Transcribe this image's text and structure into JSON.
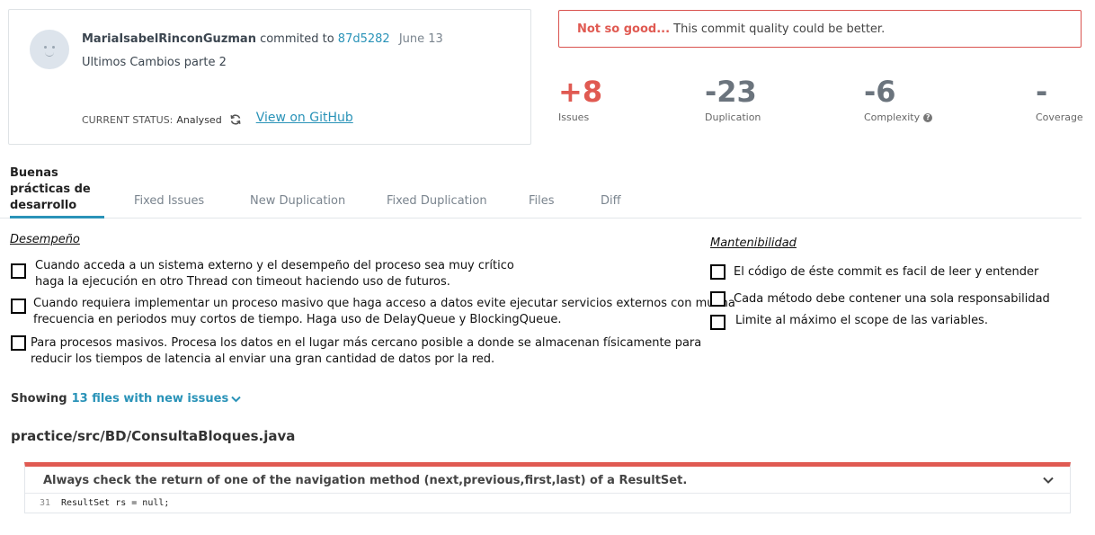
{
  "commit": {
    "author": "MariaIsabelRinconGuzman",
    "verb": " commited to ",
    "hash": "87d5282",
    "date": "June 13",
    "message": "Ultimos Cambios parte 2",
    "status_label": "CURRENT STATUS:",
    "status_value": "Analysed",
    "github_link": "View on GitHub"
  },
  "quality": {
    "strong": "Not so good...",
    "text": " This commit quality could be better."
  },
  "metrics": [
    {
      "value": "+8",
      "label": "Issues",
      "color": "#e05a52"
    },
    {
      "value": "-23",
      "label": "Duplication",
      "color": "#6b747d"
    },
    {
      "value": "-6",
      "label": "Complexity",
      "color": "#6b747d"
    },
    {
      "value": "-",
      "label": "Coverage",
      "color": "#6b747d"
    }
  ],
  "tabs": {
    "active": [
      "Buenas",
      "prácticas de",
      "desarrollo"
    ],
    "items": [
      "Fixed Issues",
      "New Duplication",
      "Fixed Duplication",
      "Files",
      "Diff"
    ]
  },
  "desempeno": {
    "title": "Desempeño",
    "items": [
      [
        "Cuando acceda a un sistema externo y el desempeño del proceso sea muy crítico",
        "haga la ejecución en otro Thread con timeout haciendo uso de futuros."
      ],
      [
        "Cuando requiera implementar un proceso masivo que haga acceso a datos evite ejecutar servicios externos con mucha",
        "frecuencia en periodos muy cortos de tiempo. Haga uso de DelayQueue y BlockingQueue."
      ],
      [
        "Para procesos masivos. Procesa los datos en el lugar más cercano posible a donde se almacenan físicamente para",
        "reducir los tiempos de latencia al enviar una gran cantidad de datos por la red."
      ]
    ]
  },
  "mantenibilidad": {
    "title": "Mantenibilidad",
    "items": [
      "El código de éste commit es facil de leer y entender",
      "Cada método debe contener una sola responsabilidad",
      "Limite al máximo el scope de las variables."
    ]
  },
  "showing": {
    "label": "Showing",
    "link": "13 files with new issues"
  },
  "file": {
    "path": "practice/src/BD/ConsultaBloques.java",
    "issue_title": "Always check the return of one of the navigation method (next,previous,first,last) of a ResultSet.",
    "line_number": "31",
    "code": "ResultSet rs = null;"
  },
  "colors": {
    "accent": "#2a93b8",
    "danger": "#e05a52"
  }
}
